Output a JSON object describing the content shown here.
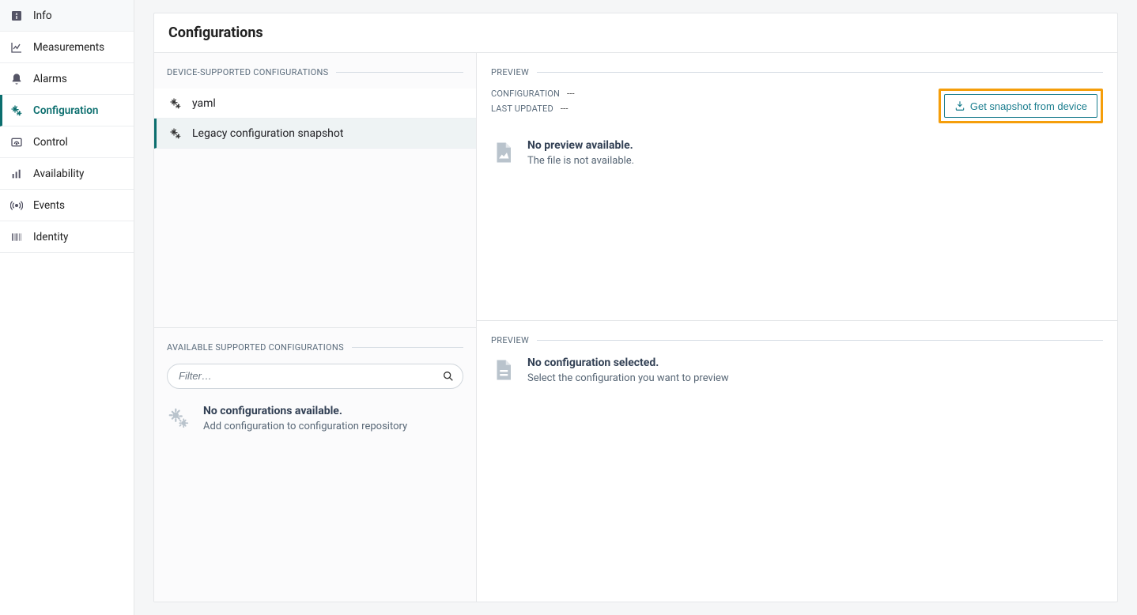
{
  "sidebar": {
    "items": [
      {
        "label": "Info",
        "icon": "info-square-icon"
      },
      {
        "label": "Measurements",
        "icon": "chart-line-icon"
      },
      {
        "label": "Alarms",
        "icon": "bell-icon"
      },
      {
        "label": "Configuration",
        "icon": "gears-icon"
      },
      {
        "label": "Control",
        "icon": "gauge-icon"
      },
      {
        "label": "Availability",
        "icon": "bars-icon"
      },
      {
        "label": "Events",
        "icon": "broadcast-icon"
      },
      {
        "label": "Identity",
        "icon": "barcode-icon"
      }
    ],
    "active_index": 3
  },
  "main": {
    "title": "Configurations",
    "device_supported": {
      "legend": "DEVICE-SUPPORTED CONFIGURATIONS",
      "items": [
        {
          "label": "yaml"
        },
        {
          "label": "Legacy configuration snapshot"
        }
      ],
      "selected_index": 1
    },
    "available_supported": {
      "legend": "AVAILABLE SUPPORTED CONFIGURATIONS",
      "filter_placeholder": "Filter…",
      "empty_title": "No configurations available.",
      "empty_subtitle": "Add configuration to configuration repository"
    },
    "preview_top": {
      "legend": "PREVIEW",
      "config_label": "CONFIGURATION",
      "config_value": "---",
      "updated_label": "LAST UPDATED",
      "updated_value": "---",
      "snapshot_button": "Get snapshot from device",
      "empty_title": "No preview available.",
      "empty_subtitle": "The file is not available."
    },
    "preview_bottom": {
      "legend": "PREVIEW",
      "empty_title": "No configuration selected.",
      "empty_subtitle": "Select the configuration you want to preview"
    }
  }
}
